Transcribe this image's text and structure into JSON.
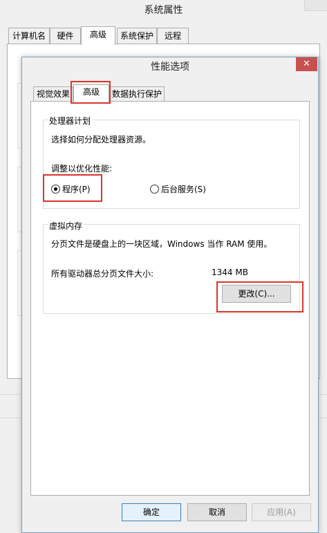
{
  "system_properties": {
    "title": "系统属性",
    "tabs": [
      "计算机名",
      "硬件",
      "高级",
      "系统保护",
      "远程"
    ],
    "active_tab": 2
  },
  "performance_options": {
    "title": "性能选项",
    "close_glyph": "✕",
    "tabs": [
      "视觉效果",
      "高级",
      "数据执行保护"
    ],
    "active_tab": 1,
    "processor": {
      "legend": "处理器计划",
      "description": "选择如何分配处理器资源。",
      "adjust_label": "调整以优化性能:",
      "options": [
        {
          "label": "程序(P)",
          "checked": true
        },
        {
          "label": "后台服务(S)",
          "checked": false
        }
      ]
    },
    "virtual_memory": {
      "legend": "虚拟内存",
      "description": "分页文件是硬盘上的一块区域，Windows 当作 RAM 使用。",
      "total_label": "所有驱动器总分页文件大小:",
      "total_value": "1344 MB",
      "change_button": "更改(C)..."
    },
    "buttons": {
      "ok": "确定",
      "cancel": "取消",
      "apply": "应用(A)"
    }
  },
  "colors": {
    "highlight": "#d9342b",
    "close_button": "#c75050"
  }
}
